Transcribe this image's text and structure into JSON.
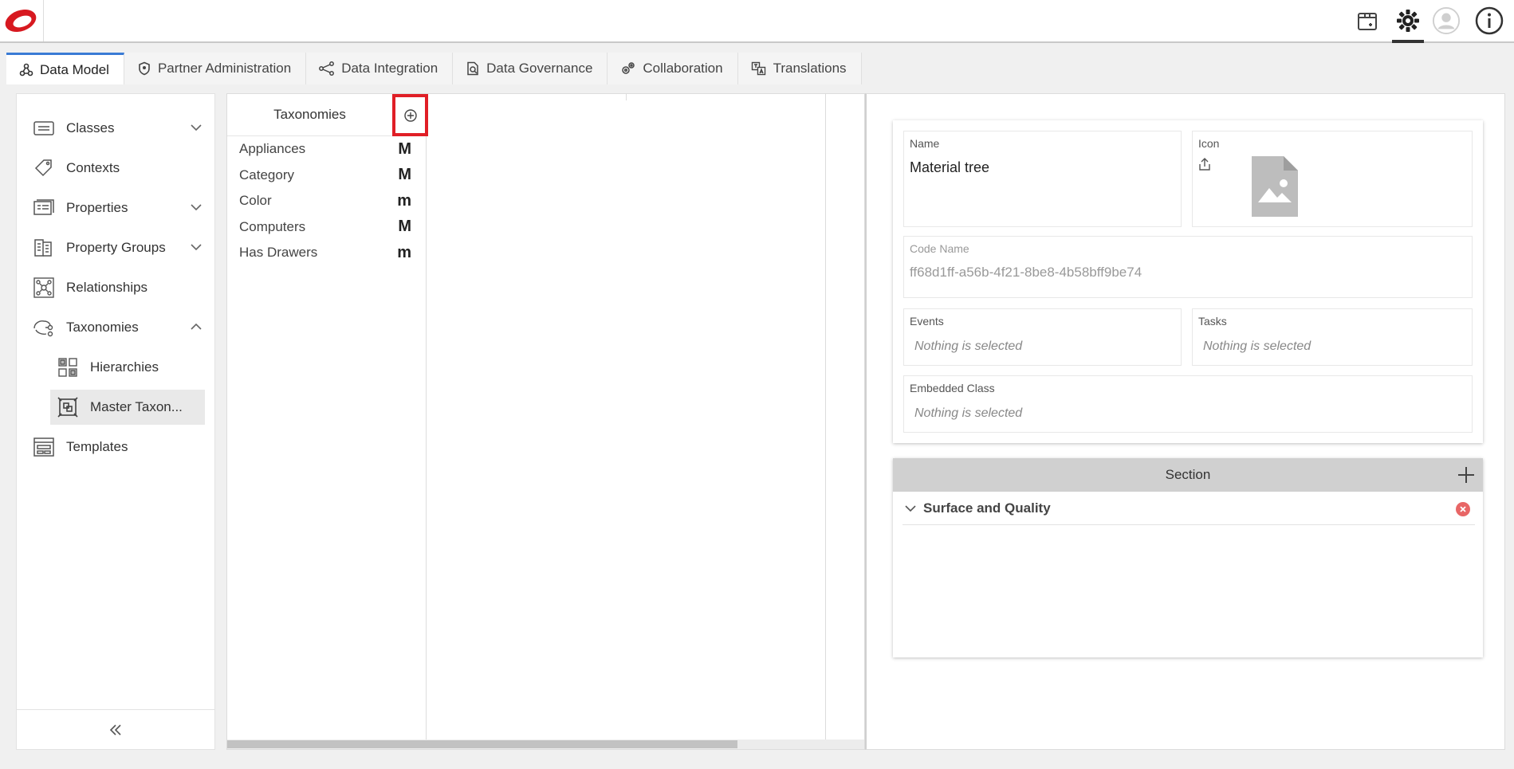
{
  "topbar": {
    "logo": "brand-logo",
    "icons": [
      "package-icon",
      "gear-icon",
      "user-avatar-icon",
      "info-icon"
    ]
  },
  "tabs": [
    {
      "label": "Data Model",
      "icon": "data-model-icon",
      "active": true
    },
    {
      "label": "Partner Administration",
      "icon": "shield-icon"
    },
    {
      "label": "Data Integration",
      "icon": "integration-icon"
    },
    {
      "label": "Data Governance",
      "icon": "governance-icon"
    },
    {
      "label": "Collaboration",
      "icon": "gears-icon"
    },
    {
      "label": "Translations",
      "icon": "translate-icon"
    }
  ],
  "sidebar": {
    "items": [
      {
        "label": "Classes",
        "icon": "classes-icon",
        "expandable": true
      },
      {
        "label": "Contexts",
        "icon": "tag-icon"
      },
      {
        "label": "Properties",
        "icon": "properties-icon",
        "expandable": true
      },
      {
        "label": "Property Groups",
        "icon": "property-groups-icon",
        "expandable": true
      },
      {
        "label": "Relationships",
        "icon": "relationships-icon"
      },
      {
        "label": "Taxonomies",
        "icon": "taxonomies-icon",
        "expandable": true,
        "expanded": true
      },
      {
        "label": "Hierarchies",
        "icon": "hierarchies-icon",
        "sub": true
      },
      {
        "label": "Master Taxon...",
        "icon": "master-taxonomy-icon",
        "sub": true,
        "selected": true
      },
      {
        "label": "Templates",
        "icon": "templates-icon"
      }
    ]
  },
  "taxonomies": {
    "title": "Taxonomies",
    "items": [
      {
        "label": "Appliances",
        "badge": "M"
      },
      {
        "label": "Category",
        "badge": "M"
      },
      {
        "label": "Color",
        "badge": "m"
      },
      {
        "label": "Computers",
        "badge": "M"
      },
      {
        "label": "Has Drawers",
        "badge": "m"
      }
    ]
  },
  "detail": {
    "name": {
      "label": "Name",
      "value": "Material tree"
    },
    "icon": {
      "label": "Icon"
    },
    "code_name": {
      "label": "Code Name",
      "value": "ff68d1ff-a56b-4f21-8be8-4b58bff9be74"
    },
    "events": {
      "label": "Events",
      "placeholder": "Nothing is selected"
    },
    "tasks": {
      "label": "Tasks",
      "placeholder": "Nothing is selected"
    },
    "embedded_class": {
      "label": "Embedded Class",
      "placeholder": "Nothing is selected"
    },
    "section": {
      "title": "Section",
      "rows": [
        {
          "label": "Surface and Quality"
        }
      ]
    }
  },
  "colors": {
    "brand_red": "#e01e26",
    "accent_blue": "#3a7bd5",
    "remove_red": "#e86666"
  }
}
